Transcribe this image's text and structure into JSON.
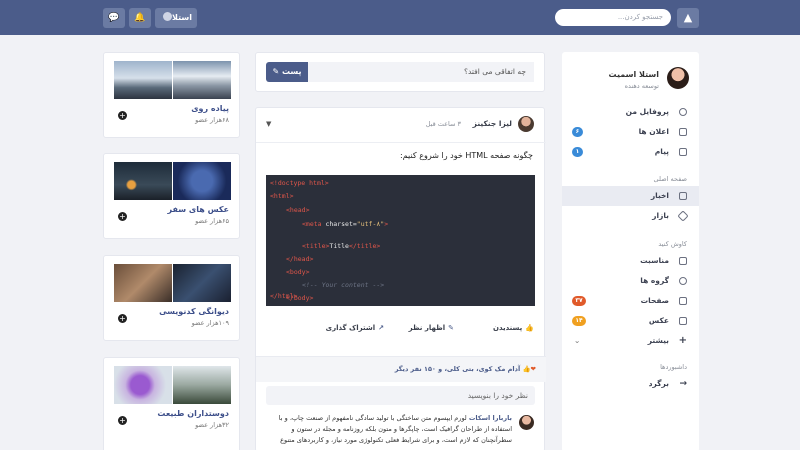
{
  "topbar": {
    "search_placeholder": "جستجو کردن...",
    "user_label": "استلا",
    "logo_icon": "tent-logo-icon",
    "chat_icon": "chat-icon",
    "bell_icon": "bell-icon"
  },
  "profile": {
    "name": "استلا اسمیت",
    "role": "توسعه دهنده"
  },
  "nav": {
    "top": [
      {
        "label": "پروفایل من",
        "icon": "user-icon"
      },
      {
        "label": "اعلان ها",
        "icon": "bell-icon",
        "badge": "۶",
        "badge_color": "#3a8bd8"
      },
      {
        "label": "پیام",
        "icon": "mail-icon",
        "badge": "۱",
        "badge_color": "#3a8bd8"
      }
    ],
    "home_title": "صفحه اصلی",
    "home": [
      {
        "label": "اخبار",
        "icon": "newspaper-icon"
      },
      {
        "label": "بازار",
        "icon": "diamond-icon"
      }
    ],
    "explore_title": "کاوش کنید",
    "explore": [
      {
        "label": "مناسبت",
        "icon": "calendar-icon"
      },
      {
        "label": "گروه ها",
        "icon": "users-icon"
      },
      {
        "label": "صفحات",
        "icon": "file-icon",
        "badge": "۳۷",
        "badge_color": "#e05a2a"
      },
      {
        "label": "عکس",
        "icon": "image-icon",
        "badge": "۱۴",
        "badge_color": "#f0a020"
      },
      {
        "label": "بیشتر",
        "icon": "plus-icon"
      }
    ],
    "dashboard_title": "داشبوردها",
    "back_label": "برگرد"
  },
  "composer": {
    "placeholder": "چه اتفاقی می افتد؟",
    "post_label": "پست"
  },
  "post": {
    "author": "لیزا جنکینز",
    "time": "۳ ساعت قبل",
    "text": "چگونه صفحه HTML خود را شروع کنیم:",
    "code": {
      "l1": "<!doctype html>",
      "l2": "<html>",
      "l3": "<head>",
      "l4a": "<meta ",
      "l4b": "charset=",
      "l4c": "\"utf-۸\"",
      "l4d": ">",
      "l5a": "<title>",
      "l5b": "Title",
      "l5c": "</title>",
      "l6": "</head>",
      "l7": "<body>",
      "l8": "<!-- Your content -->",
      "l9": "</body>",
      "l10": "</html>"
    },
    "actions": {
      "like": "پسندیدن",
      "comment": "اظهار نظر",
      "share": "اشتراک گذاری"
    },
    "likes_text": "آدام مک کوی، بتی کلی، و ۱۵۰ نفر دیگر",
    "comment_placeholder": "نظر خود را بنویسید",
    "comment": {
      "author": "باربارا اسکات",
      "text": "لورم ایپسوم متن ساختگی با تولید سادگی نامفهوم از صنعت چاپ، و با استفاده از طراحان گرافیک است، چاپگرها و متون بلکه روزنامه و مجله در ستون و سطرآنچنان که لازم است، و برای شرایط فعلی تکنولوژی مورد نیاز، و کاربردهای متنوع"
    }
  },
  "groups": [
    {
      "name": "پیاده روی",
      "members": "۶۸هزار عضو"
    },
    {
      "name": "عکس های سفر",
      "members": "۶۵هزار عضو"
    },
    {
      "name": "دیوانگی کدنویسی",
      "members": "۱۰۹هزار عضو"
    },
    {
      "name": "دوستداران طبیعت",
      "members": "۳۲هزار عضو"
    }
  ]
}
